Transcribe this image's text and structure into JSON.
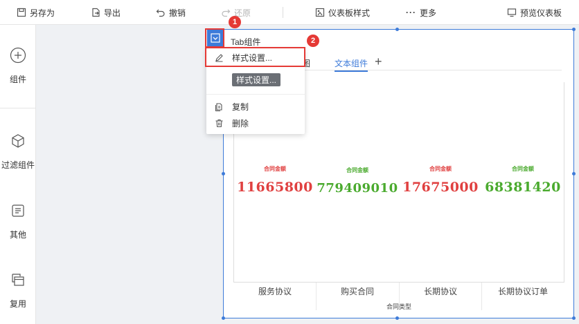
{
  "toolbar": {
    "save_as": "另存为",
    "export": "导出",
    "undo": "撤销",
    "redo": "还原",
    "dashboard_style": "仪表板样式",
    "more": "更多",
    "preview": "预览仪表板"
  },
  "sidebar": {
    "items": [
      {
        "label": "组件",
        "icon": "plus-circle-icon"
      },
      {
        "label": "过滤组件",
        "icon": "cube-icon"
      },
      {
        "label": "其他",
        "icon": "document-icon"
      },
      {
        "label": "复用",
        "icon": "copy-stack-icon"
      }
    ]
  },
  "widget": {
    "title": "Tab组件",
    "tabs": [
      {
        "label": "饼图"
      },
      {
        "label": "文本组件"
      }
    ],
    "add_tab": "+"
  },
  "menu": {
    "style_settings": "样式设置...",
    "tooltip": "样式设置...",
    "copy": "复制",
    "delete": "删除"
  },
  "badges": [
    "1",
    "2"
  ],
  "colors": {
    "accent": "#3d7bd9",
    "red_value": "#e04040",
    "green_value": "#4aaa2e",
    "highlight": "#e53935"
  },
  "chart_data": {
    "type": "table",
    "xlabel": "合同类型",
    "categories": [
      "服务协议",
      "购买合同",
      "长期协议",
      "长期协议订单"
    ],
    "metric_label": "合同金额",
    "values": [
      11665800,
      779409010,
      17675000,
      68381420
    ],
    "value_colors": [
      "red",
      "green",
      "red",
      "green"
    ],
    "display": {
      "cells": [
        {
          "caption": "合同金额",
          "value": "11665800"
        },
        {
          "caption": "合同金额",
          "value": "779409010"
        },
        {
          "caption": "合同金额",
          "value": "17675000"
        },
        {
          "caption": "合同金额",
          "value": "68381420"
        }
      ]
    }
  }
}
